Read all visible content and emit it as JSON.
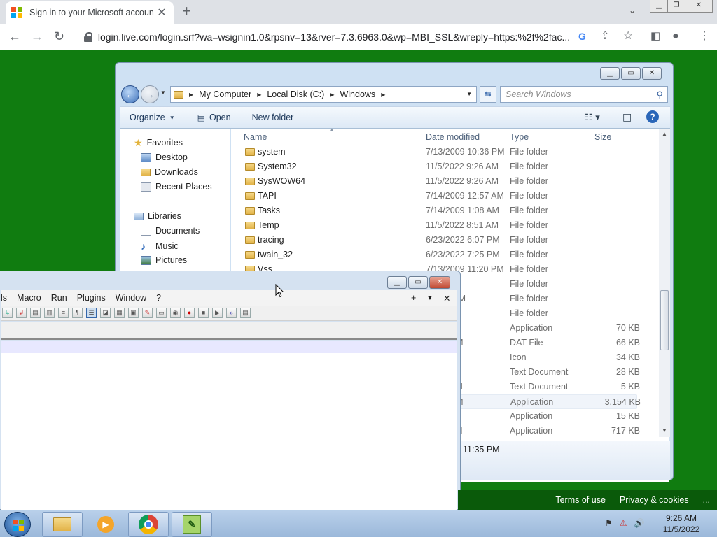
{
  "browser": {
    "tab_title": "Sign in to your Microsoft accoun",
    "url": "login.live.com/login.srf?wa=wsignin1.0&rpsnv=13&rver=7.3.6963.0&wp=MBI_SSL&wreply=https:%2f%2fac..."
  },
  "explorer": {
    "breadcrumb": [
      "My Computer",
      "Local Disk (C:)",
      "Windows"
    ],
    "search_placeholder": "Search Windows",
    "commands": {
      "organize": "Organize",
      "open": "Open",
      "new_folder": "New folder"
    },
    "nav": {
      "favorites": "Favorites",
      "favorites_items": [
        "Desktop",
        "Downloads",
        "Recent Places"
      ],
      "libraries": "Libraries",
      "libraries_items": [
        "Documents",
        "Music",
        "Pictures"
      ]
    },
    "columns": {
      "name": "Name",
      "date": "Date modified",
      "type": "Type",
      "size": "Size"
    },
    "rows": [
      {
        "name": "system",
        "date": "7/13/2009 10:36 PM",
        "type": "File folder",
        "size": ""
      },
      {
        "name": "System32",
        "date": "11/5/2022 9:26 AM",
        "type": "File folder",
        "size": ""
      },
      {
        "name": "SysWOW64",
        "date": "11/5/2022 9:26 AM",
        "type": "File folder",
        "size": ""
      },
      {
        "name": "TAPI",
        "date": "7/14/2009 12:57 AM",
        "type": "File folder",
        "size": ""
      },
      {
        "name": "Tasks",
        "date": "7/14/2009 1:08 AM",
        "type": "File folder",
        "size": ""
      },
      {
        "name": "Temp",
        "date": "11/5/2022 8:51 AM",
        "type": "File folder",
        "size": ""
      },
      {
        "name": "tracing",
        "date": "6/23/2022 6:07 PM",
        "type": "File folder",
        "size": ""
      },
      {
        "name": "twain_32",
        "date": "6/23/2022 7:25 PM",
        "type": "File folder",
        "size": ""
      },
      {
        "name": "Vss",
        "date": "7/13/2009 11:20 PM",
        "type": "File folder",
        "size": ""
      },
      {
        "name": "",
        "date": "1:32 AM",
        "type": "File folder",
        "size": ""
      },
      {
        "name": "",
        "date": "2 8:57 PM",
        "type": "File folder",
        "size": ""
      },
      {
        "name": "",
        "date": "7:37 PM",
        "type": "File folder",
        "size": ""
      },
      {
        "name": "",
        "date": "10:24 ...",
        "type": "Application",
        "size": "70 KB"
      },
      {
        "name": "",
        "date": "12:47 PM",
        "type": "DAT File",
        "size": "66 KB"
      },
      {
        "name": "",
        "date": "1:23 PM",
        "type": "Icon",
        "size": "34 KB"
      },
      {
        "name": "",
        "date": "8:43 AM",
        "type": "Text Document",
        "size": "28 KB"
      },
      {
        "name": "",
        "date": "12:03 AM",
        "type": "Text Document",
        "size": "5 KB"
      },
      {
        "name": "",
        "date": "11:35 PM",
        "type": "Application",
        "size": "3,154 KB"
      },
      {
        "name": "",
        "date": "9:39 PM",
        "type": "Application",
        "size": "15 KB"
      },
      {
        "name": "",
        "date": "11:37 PM",
        "type": "Application",
        "size": "717 KB"
      }
    ],
    "details_text": "11:35 PM"
  },
  "npp": {
    "menu": [
      "ls",
      "Macro",
      "Run",
      "Plugins",
      "Window",
      "?"
    ],
    "tab_controls": [
      "+",
      "▼",
      "✕"
    ]
  },
  "ms_footer": {
    "terms": "Terms of use",
    "privacy": "Privacy & cookies",
    "more": "..."
  },
  "taskbar": {
    "time": "9:26 AM",
    "date": "11/5/2022"
  },
  "colors": {
    "desktop_green": "#107c10",
    "ms_red": "#f25022",
    "ms_green": "#7fba00",
    "ms_blue": "#00a4ef",
    "ms_yellow": "#ffb900"
  }
}
